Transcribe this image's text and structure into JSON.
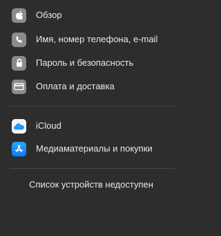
{
  "sidebar": {
    "items": [
      {
        "label": "Обзор",
        "icon": "apple-logo-icon"
      },
      {
        "label": "Имя, номер телефона, e-mail",
        "icon": "phone-icon"
      },
      {
        "label": "Пароль и безопасность",
        "icon": "lock-icon"
      },
      {
        "label": "Оплата и доставка",
        "icon": "credit-card-icon"
      }
    ],
    "services": [
      {
        "label": "iCloud",
        "icon": "icloud-icon"
      },
      {
        "label": "Медиаматериалы и покупки",
        "icon": "app-store-icon"
      }
    ],
    "devices_status": "Список устройств недоступен"
  },
  "colors": {
    "background": "#2d2d2e",
    "divider": "#474749",
    "icon_gray": "#8b8b8f",
    "icloud_blue": "#1e9bff",
    "app_store_blue": "#0a7bff"
  }
}
